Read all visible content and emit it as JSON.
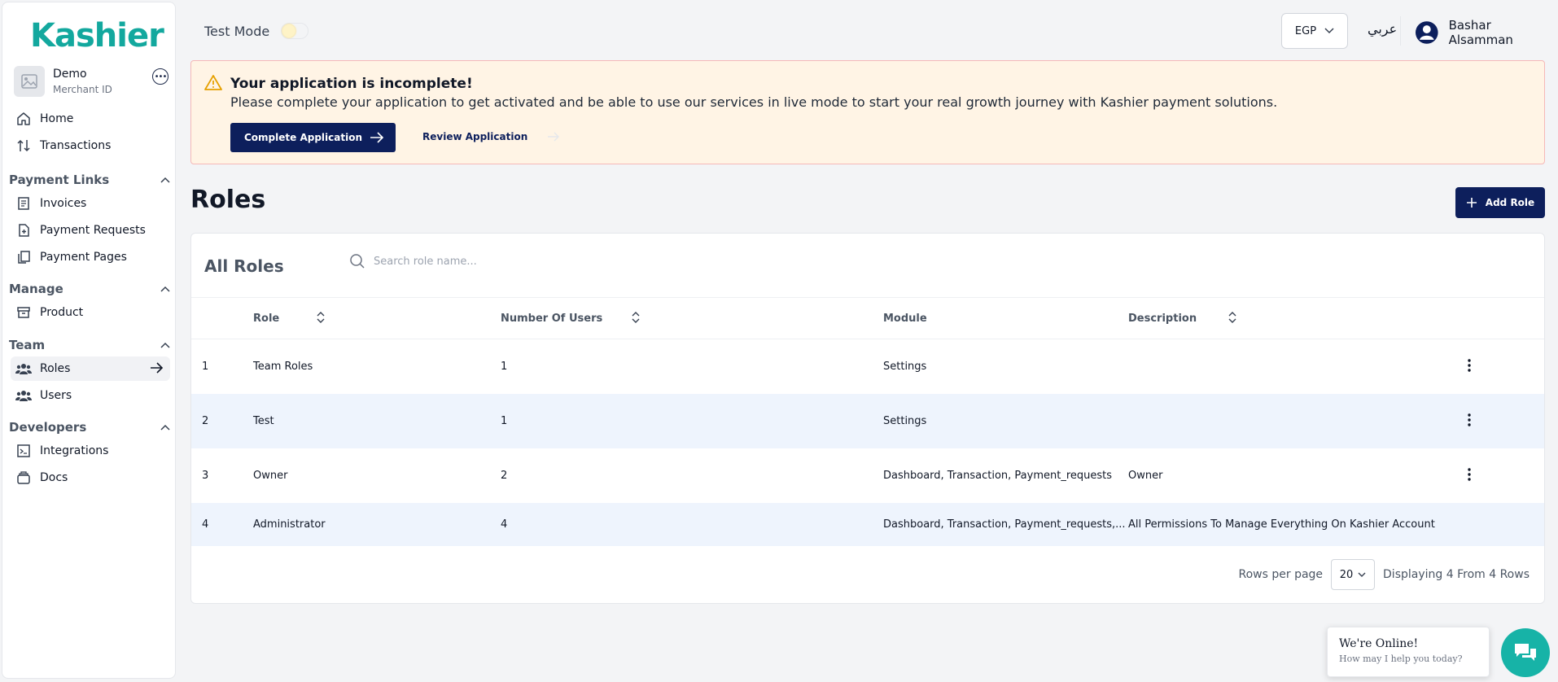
{
  "brand": {
    "logo": "Kashier",
    "color": "#13a89e"
  },
  "merchant": {
    "name": "Demo",
    "id_label": "Merchant ID"
  },
  "nav": {
    "home": "Home",
    "transactions": "Transactions",
    "payment_links": "Payment Links",
    "invoices": "Invoices",
    "payment_requests": "Payment Requests",
    "payment_pages": "Payment Pages",
    "manage": "Manage",
    "product": "Product",
    "team": "Team",
    "roles": "Roles",
    "users": "Users",
    "developers": "Developers",
    "integrations": "Integrations",
    "docs": "Docs"
  },
  "topbar": {
    "test_mode": "Test Mode",
    "currency": "EGP",
    "language": "عربي",
    "user_name": "Bashar Alsamman"
  },
  "banner": {
    "title": "Your application is incomplete!",
    "message": "Please complete your application to get activated and be able to use our services in live mode to start your real growth journey with Kashier payment solutions.",
    "complete_button": "Complete Application",
    "review_button": "Review Application"
  },
  "page": {
    "title": "Roles",
    "add_button": "Add Role"
  },
  "table": {
    "title": "All Roles",
    "search_placeholder": "Search role name...",
    "headers": {
      "role": "Role",
      "users": "Number Of Users",
      "module": "Module",
      "description": "Description"
    },
    "rows": [
      {
        "index": "1",
        "role": "Team Roles",
        "users": "1",
        "module": "Settings",
        "description": ""
      },
      {
        "index": "2",
        "role": "Test",
        "users": "1",
        "module": "Settings",
        "description": ""
      },
      {
        "index": "3",
        "role": "Owner",
        "users": "2",
        "module": "Dashboard, Transaction, Payment_requests",
        "description": "Owner"
      },
      {
        "index": "4",
        "role": "Administrator",
        "users": "4",
        "module": "Dashboard, Transaction, Payment_requests,...",
        "description": "All Permissions To Manage Everything On Kashier Account"
      }
    ],
    "rows_per_page_label": "Rows per page",
    "rows_per_page": "20",
    "displaying": "Displaying 4 From 4 Rows"
  },
  "chat": {
    "title": "We're Online!",
    "subtitle": "How may I help you today?"
  }
}
